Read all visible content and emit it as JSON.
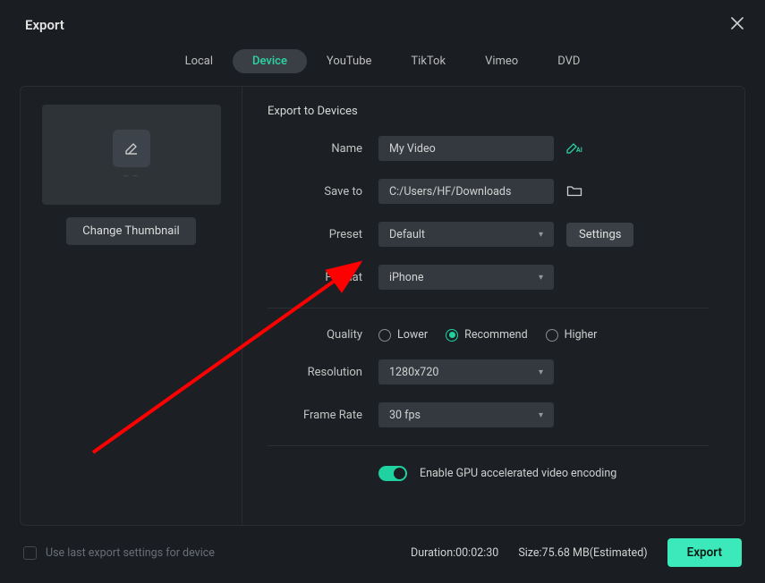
{
  "title": "Export",
  "tabs": {
    "local": "Local",
    "device": "Device",
    "youtube": "YouTube",
    "tiktok": "TikTok",
    "vimeo": "Vimeo",
    "dvd": "DVD"
  },
  "thumbnail": {
    "change_label": "Change Thumbnail"
  },
  "section": {
    "title": "Export to Devices"
  },
  "fields": {
    "name": {
      "label": "Name",
      "value": "My Video"
    },
    "saveto": {
      "label": "Save to",
      "value": "C:/Users/HF/Downloads"
    },
    "preset": {
      "label": "Preset",
      "value": "Default",
      "settings": "Settings"
    },
    "format": {
      "label": "Format",
      "value": "iPhone"
    },
    "quality": {
      "label": "Quality",
      "lower": "Lower",
      "recommend": "Recommend",
      "higher": "Higher"
    },
    "resolution": {
      "label": "Resolution",
      "value": "1280x720"
    },
    "framerate": {
      "label": "Frame Rate",
      "value": "30 fps"
    }
  },
  "gpu": {
    "label": "Enable GPU accelerated video encoding"
  },
  "footer": {
    "use_last": "Use last export settings for device",
    "duration": "Duration:00:02:30",
    "size": "Size:75.68 MB(Estimated)",
    "export": "Export"
  },
  "accent": "#1fd2a0"
}
